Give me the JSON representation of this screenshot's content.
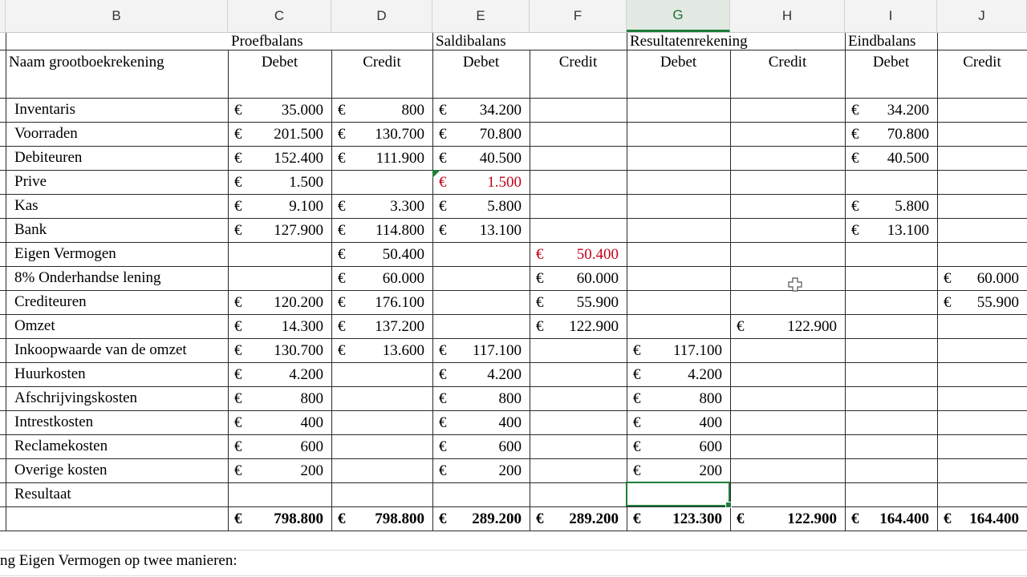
{
  "column_headers": [
    "B",
    "C",
    "D",
    "E",
    "F",
    "G",
    "H",
    "I",
    "J"
  ],
  "selected_column": "G",
  "sections": {
    "proefbalans": "Proefbalans",
    "saldibalans": "Saldibalans",
    "resultatenrekening": "Resultatenrekening",
    "eindbalans": "Eindbalans"
  },
  "account_header": "Naam grootboekrekening",
  "debet_label": "Debet",
  "credit_label": "Credit",
  "currency": "€",
  "rows": [
    {
      "name": "Inventaris",
      "c": "35.000",
      "d": "800",
      "e": "34.200",
      "f": "",
      "g": "",
      "h": "",
      "i": "34.200",
      "j": ""
    },
    {
      "name": "Voorraden",
      "c": "201.500",
      "d": "130.700",
      "e": "70.800",
      "f": "",
      "g": "",
      "h": "",
      "i": "70.800",
      "j": ""
    },
    {
      "name": "Debiteuren",
      "c": "152.400",
      "d": "111.900",
      "e": "40.500",
      "f": "",
      "g": "",
      "h": "",
      "i": "40.500",
      "j": ""
    },
    {
      "name": "Prive",
      "c": "1.500",
      "d": "",
      "e": "1.500",
      "f": "",
      "g": "",
      "h": "",
      "i": "",
      "j": ""
    },
    {
      "name": "Kas",
      "c": "9.100",
      "d": "3.300",
      "e": "5.800",
      "f": "",
      "g": "",
      "h": "",
      "i": "5.800",
      "j": ""
    },
    {
      "name": "Bank",
      "c": "127.900",
      "d": "114.800",
      "e": "13.100",
      "f": "",
      "g": "",
      "h": "",
      "i": "13.100",
      "j": ""
    },
    {
      "name": "Eigen Vermogen",
      "c": "",
      "d": "50.400",
      "e": "",
      "f": "50.400",
      "g": "",
      "h": "",
      "i": "",
      "j": ""
    },
    {
      "name": "8% Onderhandse lening",
      "c": "",
      "d": "60.000",
      "e": "",
      "f": "60.000",
      "g": "",
      "h": "",
      "i": "",
      "j": "60.000"
    },
    {
      "name": "Crediteuren",
      "c": "120.200",
      "d": "176.100",
      "e": "",
      "f": "55.900",
      "g": "",
      "h": "",
      "i": "",
      "j": "55.900"
    },
    {
      "name": "Omzet",
      "c": "14.300",
      "d": "137.200",
      "e": "",
      "f": "122.900",
      "g": "",
      "h": "122.900",
      "i": "",
      "j": ""
    },
    {
      "name": "Inkoopwaarde van de omzet",
      "c": "130.700",
      "d": "13.600",
      "e": "117.100",
      "f": "",
      "g": "117.100",
      "h": "",
      "i": "",
      "j": ""
    },
    {
      "name": "Huurkosten",
      "c": "4.200",
      "d": "",
      "e": "4.200",
      "f": "",
      "g": "4.200",
      "h": "",
      "i": "",
      "j": ""
    },
    {
      "name": "Afschrijvingskosten",
      "c": "800",
      "d": "",
      "e": "800",
      "f": "",
      "g": "800",
      "h": "",
      "i": "",
      "j": ""
    },
    {
      "name": "Intrestkosten",
      "c": "400",
      "d": "",
      "e": "400",
      "f": "",
      "g": "400",
      "h": "",
      "i": "",
      "j": ""
    },
    {
      "name": "Reclamekosten",
      "c": "600",
      "d": "",
      "e": "600",
      "f": "",
      "g": "600",
      "h": "",
      "i": "",
      "j": ""
    },
    {
      "name": "Overige kosten",
      "c": "200",
      "d": "",
      "e": "200",
      "f": "",
      "g": "200",
      "h": "",
      "i": "",
      "j": ""
    },
    {
      "name": "Resultaat",
      "c": "",
      "d": "",
      "e": "",
      "f": "",
      "g": "",
      "h": "",
      "i": "",
      "j": ""
    }
  ],
  "negative_cells": [
    {
      "row": 3,
      "col": "e"
    },
    {
      "row": 6,
      "col": "f"
    }
  ],
  "totals": {
    "c": "798.800",
    "d": "798.800",
    "e": "289.200",
    "f": "289.200",
    "g": "123.300",
    "h": "122.900",
    "i": "164.400",
    "j": "164.400"
  },
  "note": "ng Eigen Vermogen op twee manieren:",
  "colors": {
    "negative": "#c4001d",
    "selection": "#1e7d3a"
  }
}
